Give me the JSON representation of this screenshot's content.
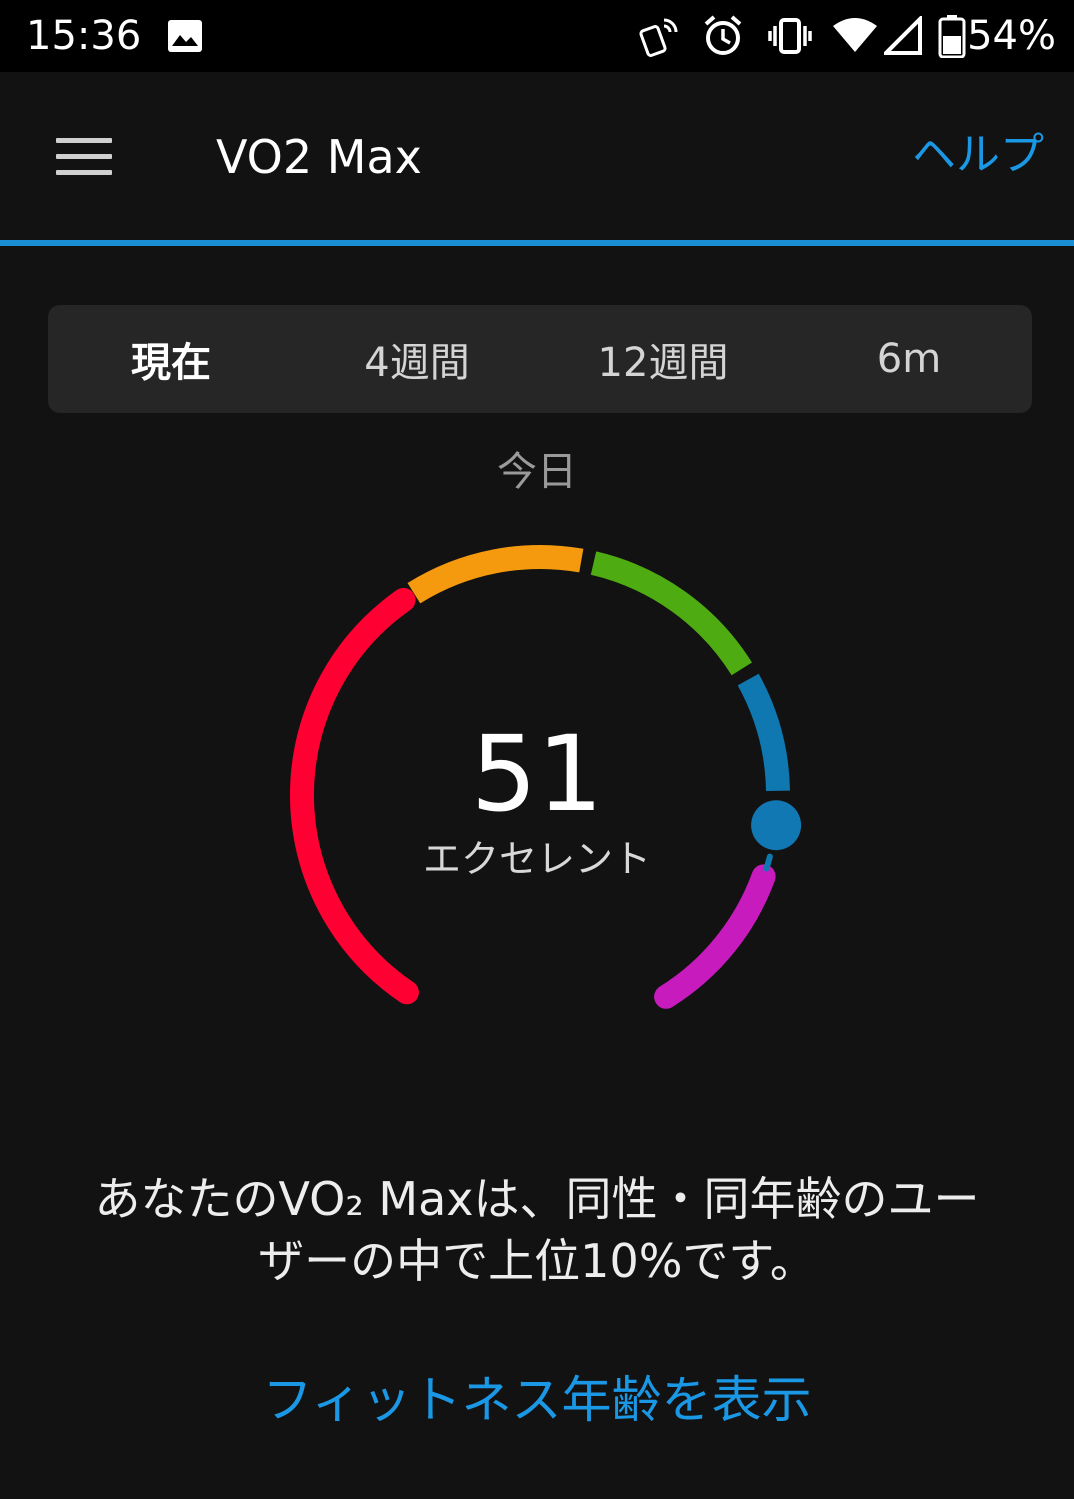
{
  "status_bar": {
    "time": "15:36",
    "battery_percent": "54%",
    "icons": [
      "image-icon",
      "nfc-payment-icon",
      "alarm-icon",
      "vibrate-icon",
      "wifi-icon",
      "signal-icon",
      "battery-icon"
    ]
  },
  "app_bar": {
    "title": "VO2 Max",
    "help_label": "ヘルプ",
    "accent_color": "#1a8fd6"
  },
  "tabs": [
    {
      "label": "現在",
      "active": true
    },
    {
      "label": "4週間",
      "active": false
    },
    {
      "label": "12週間",
      "active": false
    },
    {
      "label": "6m",
      "active": false
    }
  ],
  "gauge": {
    "period_label": "今日",
    "value": "51",
    "category": "エクセレント",
    "segment_colors": [
      "#ff0033",
      "#f59a0e",
      "#4eac12",
      "#0f78b0",
      "#c71bbe"
    ],
    "marker_color": "#1178b4"
  },
  "description": {
    "line1": "あなたのVO₂ Maxは、同性・同年齢のユー",
    "line2": "ザーの中で上位10%です。"
  },
  "fitness_age_link": "フィットネス年齢を表示"
}
